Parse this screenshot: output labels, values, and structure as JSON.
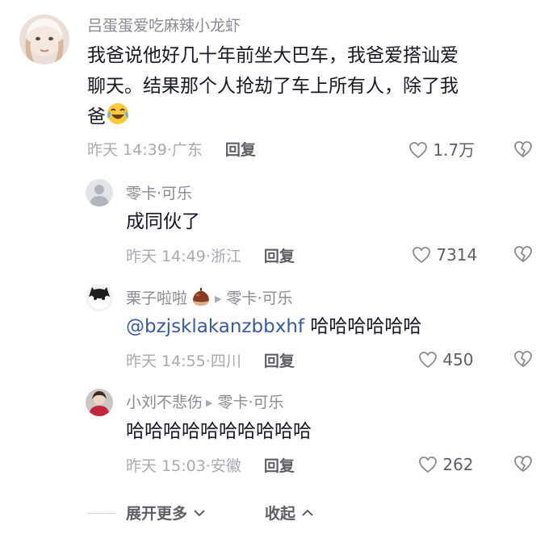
{
  "comments": [
    {
      "username": "吕蛋蛋爱吃麻辣小龙虾",
      "text_lines": [
        "我爸说他好几十年前坐大巴车，我爸爱搭讪爱",
        "聊天。结果那个人抢劫了车上所有人，除了我",
        "爸"
      ],
      "emoji": "laughing-crying-emoji",
      "time": "昨天 14:39",
      "location": "广东",
      "reply_label": "回复",
      "likes": "1.7万"
    },
    {
      "username": "零卡·可乐",
      "text": "成同伙了",
      "time": "昨天 14:49",
      "location": "浙江",
      "reply_label": "回复",
      "likes": "7314"
    },
    {
      "username": "栗子啦啦",
      "reply_to": "零卡·可乐",
      "mention": "@bzjsklakanzbbxhf",
      "text": "哈哈哈哈哈哈",
      "time": "昨天 14:55",
      "location": "四川",
      "reply_label": "回复",
      "likes": "450"
    },
    {
      "username": "小刘不悲伤",
      "reply_to": "零卡·可乐",
      "text": "哈哈哈哈哈哈哈哈哈哈",
      "time": "昨天 15:03",
      "location": "安徽",
      "reply_label": "回复",
      "likes": "262"
    }
  ],
  "footer": {
    "expand_label": "展开更多",
    "collapse_label": "收起"
  },
  "icons": {
    "like": "heart-outline-icon",
    "dislike": "broken-heart-icon",
    "reply_arrow": "triangle-right-icon"
  },
  "colors": {
    "username": "#8a8b91",
    "text": "#161823",
    "mention": "#3c5a98",
    "meta": "#a9aab0"
  }
}
